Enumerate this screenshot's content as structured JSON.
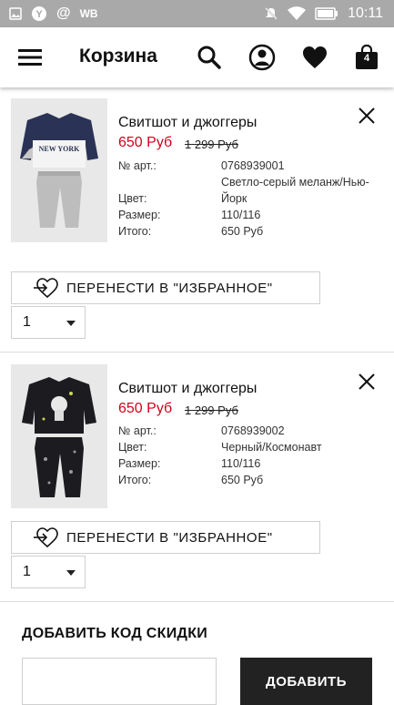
{
  "status_bar": {
    "carrier": "WB",
    "time": "10:11",
    "icons": [
      "image-icon",
      "yandex-icon",
      "at-icon",
      "mute-icon",
      "wifi-icon",
      "battery-icon"
    ]
  },
  "header": {
    "title": "Корзина",
    "bag_count": "4",
    "icons": [
      "menu-icon",
      "search-icon",
      "account-icon",
      "heart-icon",
      "bag-icon"
    ]
  },
  "items": [
    {
      "name": "Свитшот и джоггеры",
      "price": "650 Руб",
      "old_price": "1 299 Руб",
      "details": [
        {
          "label": "№ арт.:",
          "value": "0768939001"
        },
        {
          "label": "Цвет:",
          "value": "Светло-серый меланж/Нью-Йорк"
        },
        {
          "label": "Размер:",
          "value": "110/116"
        },
        {
          "label": "Итого:",
          "value": "650 Руб"
        }
      ],
      "favorite_label": "ПЕРЕНЕСТИ В \"ИЗБРАННОЕ\"",
      "quantity": "1",
      "image_text": "NEW YORK"
    },
    {
      "name": "Свитшот и джоггеры",
      "price": "650 Руб",
      "old_price": "1 299 Руб",
      "details": [
        {
          "label": "№ арт.:",
          "value": "0768939002"
        },
        {
          "label": "Цвет:",
          "value": "Черный/Космонавт"
        },
        {
          "label": "Размер:",
          "value": "110/116"
        },
        {
          "label": "Итого:",
          "value": "650 Руб"
        }
      ],
      "favorite_label": "ПЕРЕНЕСТИ В \"ИЗБРАННОЕ\"",
      "quantity": "1"
    }
  ],
  "discount": {
    "title": "ДОБАВИТЬ КОД СКИДКИ",
    "input_value": "",
    "button_label": "ДОБАВИТЬ"
  },
  "colors": {
    "sale_price": "#d0021b",
    "status_bar": "#a9a9a9",
    "button_dark": "#222222"
  }
}
